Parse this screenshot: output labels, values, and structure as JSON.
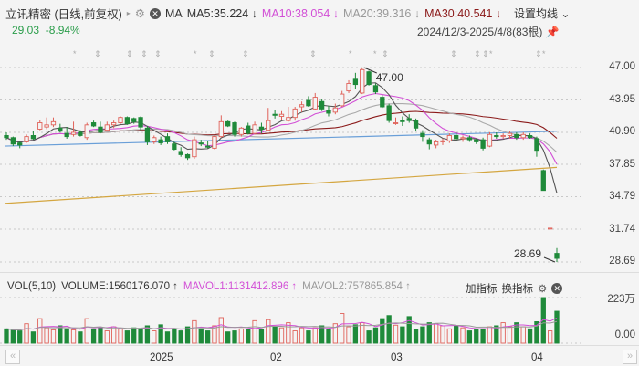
{
  "header": {
    "title": "立讯精密 (日线,前复权)",
    "ma_label": "MA",
    "ma5": "MA5:35.224 ↓",
    "ma10": "MA10:38.054 ↓",
    "ma20": "MA20:39.316 ↓",
    "ma30": "MA30:40.541 ↓",
    "set_ma": "设置均线 ⌄",
    "price": "29.03",
    "change": "-8.94%",
    "range": "2024/12/3-2025/4/8(83根)"
  },
  "colors": {
    "up": "#e0625a",
    "down": "#1f8a3a",
    "ma5": "#555555",
    "ma10": "#d24fd6",
    "ma20": "#aaaaaa",
    "ma30": "#8b1a1a",
    "ma60": "#6a9fd8",
    "ma250": "#d4a640"
  },
  "price_axis": [
    "47.00",
    "43.95",
    "40.90",
    "37.85",
    "34.79",
    "31.74",
    "28.69"
  ],
  "annotations": {
    "high": "47.00",
    "low": "28.69"
  },
  "markers": [
    "*",
    "⇕",
    "⇕",
    "⇕",
    "⇕",
    "*",
    "⇕",
    "⇕",
    "⇕",
    "*",
    "*",
    "⇕",
    "⇕",
    "⇕",
    "⇕",
    "*",
    "⇕",
    "*"
  ],
  "volume": {
    "header": "VOL(5,10)",
    "volume": "VOLUME:1560176.070 ↑",
    "mavol1": "MAVOL1:1131412.896 ↑",
    "mavol2": "MAVOL2:757865.854 ↑",
    "add": "加指标",
    "switch": "换指标",
    "axis_top": "223万",
    "axis_bottom": "0.00"
  },
  "x_axis": [
    "2025",
    "02",
    "03",
    "04"
  ],
  "chart_data": {
    "type": "candlestick",
    "ohlc": [
      [
        40.6,
        40.9,
        40.2,
        40.4
      ],
      [
        40.4,
        40.5,
        39.6,
        39.8
      ],
      [
        39.9,
        40.1,
        39.4,
        39.7
      ],
      [
        40.0,
        40.7,
        39.9,
        40.5
      ],
      [
        40.6,
        41.0,
        40.2,
        40.3
      ],
      [
        41.2,
        42.1,
        41.1,
        41.8
      ],
      [
        41.4,
        42.3,
        41.2,
        41.6
      ],
      [
        41.6,
        42.3,
        41.4,
        41.9
      ],
      [
        41.3,
        41.7,
        40.9,
        41.0
      ],
      [
        40.8,
        41.4,
        40.3,
        40.5
      ],
      [
        40.7,
        41.9,
        40.5,
        40.9
      ],
      [
        40.9,
        41.1,
        40.5,
        40.6
      ],
      [
        40.4,
        41.8,
        40.2,
        41.6
      ],
      [
        41.8,
        42.0,
        41.4,
        41.5
      ],
      [
        41.4,
        41.9,
        40.8,
        40.9
      ],
      [
        41.1,
        41.9,
        41.0,
        41.6
      ],
      [
        41.6,
        42.0,
        41.3,
        41.8
      ],
      [
        41.8,
        42.4,
        41.7,
        42.3
      ],
      [
        42.3,
        42.4,
        41.6,
        41.7
      ],
      [
        42.2,
        42.3,
        41.7,
        41.9
      ],
      [
        42.3,
        42.4,
        41.1,
        41.4
      ],
      [
        41.3,
        41.5,
        39.7,
        40.0
      ],
      [
        40.0,
        40.6,
        39.8,
        40.4
      ],
      [
        40.2,
        40.5,
        39.7,
        39.9
      ],
      [
        40.5,
        40.8,
        39.8,
        40.0
      ],
      [
        39.8,
        40.0,
        39.2,
        39.3
      ],
      [
        39.1,
        39.5,
        38.6,
        38.8
      ],
      [
        38.8,
        38.9,
        38.3,
        38.5
      ],
      [
        38.6,
        40.5,
        38.4,
        40.2
      ],
      [
        39.9,
        40.2,
        39.6,
        39.8
      ],
      [
        39.6,
        40.1,
        39.4,
        39.5
      ],
      [
        39.4,
        40.6,
        39.3,
        40.5
      ],
      [
        40.5,
        42.5,
        40.4,
        41.9
      ],
      [
        41.9,
        42.0,
        41.4,
        41.5
      ],
      [
        41.8,
        41.9,
        40.5,
        40.7
      ],
      [
        40.7,
        41.4,
        40.5,
        41.3
      ],
      [
        41.5,
        41.8,
        40.7,
        40.8
      ],
      [
        40.8,
        41.9,
        40.7,
        41.6
      ],
      [
        41.4,
        41.8,
        40.8,
        41.2
      ],
      [
        41.1,
        43.2,
        41.0,
        42.0
      ],
      [
        42.6,
        43.0,
        42.2,
        42.5
      ],
      [
        42.4,
        42.9,
        42.1,
        42.6
      ],
      [
        42.0,
        43.3,
        41.9,
        42.3
      ],
      [
        42.3,
        43.3,
        42.0,
        43.1
      ],
      [
        43.3,
        43.8,
        42.8,
        43.5
      ],
      [
        43.9,
        44.3,
        43.3,
        43.4
      ],
      [
        43.1,
        44.6,
        43.0,
        44.2
      ],
      [
        43.8,
        44.0,
        42.9,
        43.1
      ],
      [
        43.0,
        43.4,
        42.4,
        42.7
      ],
      [
        42.8,
        43.6,
        42.6,
        43.2
      ],
      [
        43.4,
        44.8,
        43.3,
        44.5
      ],
      [
        44.8,
        45.8,
        44.6,
        45.5
      ],
      [
        45.9,
        46.5,
        45.0,
        45.4
      ],
      [
        44.6,
        47.0,
        44.5,
        46.8
      ],
      [
        46.6,
        46.7,
        45.3,
        45.4
      ],
      [
        45.3,
        45.5,
        44.5,
        44.7
      ],
      [
        44.2,
        44.4,
        43.2,
        43.3
      ],
      [
        43.4,
        43.6,
        41.8,
        42.0
      ],
      [
        41.8,
        42.3,
        41.6,
        41.8
      ],
      [
        42.0,
        42.4,
        41.5,
        41.9
      ],
      [
        42.2,
        42.6,
        41.8,
        42.0
      ],
      [
        42.0,
        42.2,
        41.0,
        41.3
      ],
      [
        40.8,
        41.1,
        40.0,
        40.5
      ],
      [
        40.2,
        40.4,
        39.3,
        39.8
      ],
      [
        39.7,
        40.2,
        39.4,
        40.0
      ],
      [
        40.0,
        40.3,
        39.7,
        40.1
      ],
      [
        40.1,
        40.8,
        39.9,
        40.6
      ],
      [
        40.6,
        40.9,
        40.1,
        40.3
      ],
      [
        40.3,
        40.6,
        40.0,
        40.4
      ],
      [
        40.4,
        40.6,
        40.0,
        40.2
      ],
      [
        40.2,
        40.3,
        39.8,
        40.0
      ],
      [
        40.2,
        40.4,
        39.2,
        39.4
      ],
      [
        39.6,
        40.9,
        39.5,
        40.7
      ],
      [
        40.6,
        40.9,
        40.3,
        40.5
      ],
      [
        40.5,
        40.8,
        40.3,
        40.6
      ],
      [
        40.6,
        41.0,
        40.3,
        40.8
      ],
      [
        40.7,
        40.9,
        40.2,
        40.4
      ],
      [
        40.4,
        40.9,
        40.2,
        40.7
      ],
      [
        40.6,
        40.8,
        40.3,
        40.4
      ],
      [
        40.3,
        40.5,
        38.6,
        39.2
      ],
      [
        37.3,
        37.4,
        35.4,
        35.42
      ],
      [
        31.88,
        31.88,
        31.88,
        31.88
      ],
      [
        29.5,
        30.0,
        28.69,
        29.03
      ]
    ],
    "volume_wan": [
      70,
      62,
      60,
      95,
      55,
      120,
      75,
      65,
      85,
      70,
      65,
      55,
      120,
      70,
      75,
      60,
      80,
      70,
      60,
      75,
      70,
      85,
      60,
      90,
      55,
      72,
      60,
      80,
      110,
      70,
      60,
      85,
      125,
      55,
      60,
      70,
      65,
      110,
      68,
      115,
      80,
      75,
      100,
      60,
      75,
      60,
      75,
      85,
      70,
      95,
      145,
      80,
      90,
      100,
      60,
      75,
      120,
      135,
      88,
      80,
      130,
      65,
      80,
      100,
      95,
      85,
      70,
      85,
      75,
      60,
      65,
      70,
      80,
      85,
      100,
      80,
      100,
      80,
      70,
      105,
      223,
      60,
      156
    ],
    "ma60_range": [
      39.6,
      41.0
    ],
    "ma250_range": [
      34.2,
      37.6
    ],
    "ylim": [
      28.69,
      47.0
    ],
    "volume_max_wan": 223
  }
}
